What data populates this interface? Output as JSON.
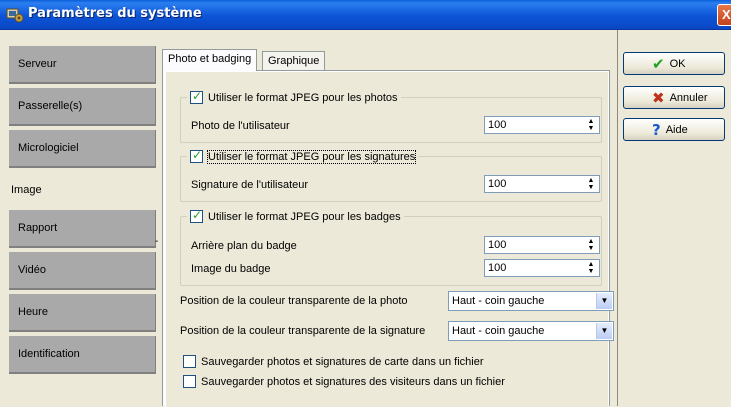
{
  "window": {
    "title": "Paramètres du système",
    "close_glyph": "X"
  },
  "sidebar": {
    "items": [
      {
        "label": "Serveur"
      },
      {
        "label": "Passerelle(s)"
      },
      {
        "label": "Micrologiciel"
      },
      {
        "label": "Image"
      },
      {
        "label": "Rapport"
      },
      {
        "label": "Vidéo"
      },
      {
        "label": "Heure"
      },
      {
        "label": "Identification"
      }
    ],
    "active_index": 3
  },
  "tabs": [
    {
      "label": "Photo et badging"
    },
    {
      "label": "Graphique"
    }
  ],
  "photos_group": {
    "checkbox_label": "Utiliser le format JPEG pour les photos",
    "checked": true,
    "field_label": "Photo de l'utilisateur",
    "field_value": "100"
  },
  "signatures_group": {
    "checkbox_label": "Utiliser le format JPEG pour les signatures",
    "checked": true,
    "field_label": "Signature de l'utilisateur",
    "field_value": "100"
  },
  "badges_group": {
    "checkbox_label": "Utiliser le format JPEG pour les badges",
    "checked": true,
    "field1_label": "Arrière plan du badge",
    "field1_value": "100",
    "field2_label": "Image du badge",
    "field2_value": "100"
  },
  "transparency": {
    "photo_label": "Position de la couleur transparente de la photo",
    "photo_value": "Haut - coin gauche",
    "signature_label": "Position de la couleur transparente de la signature",
    "signature_value": "Haut - coin gauche"
  },
  "save_options": [
    {
      "label": "Sauvegarder photos et signatures de carte dans un fichier",
      "checked": false
    },
    {
      "label": "Sauvegarder photos et signatures des visiteurs dans un fichier",
      "checked": false
    }
  ],
  "buttons": {
    "ok_label": "OK",
    "cancel_label": "Annuler",
    "help_label": "Aide"
  },
  "colors": {
    "title_bar": "#0c55d6",
    "sidebar_inactive": "#a9a9a9",
    "ok_icon": "#21a121",
    "cancel_icon": "#c0301a",
    "help_icon": "#1a5ad0"
  },
  "misc": {
    "stray_mark": "-"
  }
}
